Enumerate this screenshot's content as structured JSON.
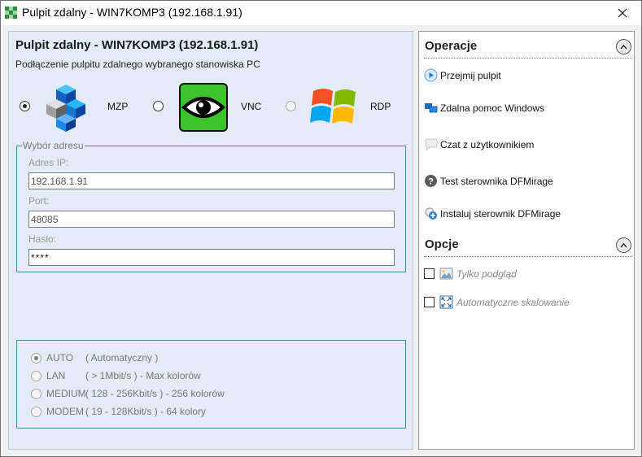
{
  "window": {
    "title": "Pulpit zdalny - WIN7KOMP3 (192.168.1.91)",
    "close_glyph": "✕"
  },
  "left": {
    "title": "Pulpit zdalny - WIN7KOMP3 (192.168.1.91)",
    "subtitle": "Podłączenie pulpitu zdalnego wybranego stanowiska PC",
    "methods": [
      {
        "label": "MZP",
        "selected": true,
        "enabled": true,
        "icon": "mzp-cubes-icon"
      },
      {
        "label": "VNC",
        "selected": false,
        "enabled": true,
        "icon": "vnc-eye-icon"
      },
      {
        "label": "RDP",
        "selected": false,
        "enabled": false,
        "icon": "windows-logo-icon"
      }
    ],
    "address": {
      "legend": "Wybór adresu",
      "ip_label": "Adres IP:",
      "ip_value": "192.168.1.91",
      "port_label": "Port:",
      "port_value": "48085",
      "password_label": "Hasło:",
      "password_value": "****"
    },
    "quality": [
      {
        "name": "AUTO",
        "desc": "( Automatyczny )",
        "selected": true
      },
      {
        "name": "LAN",
        "desc": "( > 1Mbit/s ) - Max kolorów",
        "selected": false
      },
      {
        "name": "MEDIUM",
        "desc": "( 128 - 256Kbit/s ) - 256 kolorów",
        "selected": false
      },
      {
        "name": "MODEM",
        "desc": "( 19 - 128Kbit/s ) - 64 kolory",
        "selected": false
      }
    ]
  },
  "right": {
    "operations_title": "Operacje",
    "operations": [
      {
        "label": "Przejmij pulpit",
        "icon": "play-icon"
      },
      {
        "label": "Zdalna pomoc Windows",
        "icon": "remote-help-icon"
      },
      {
        "label": "Czat z użytkownikiem",
        "icon": "chat-bubble-icon"
      },
      {
        "label": "Test sterownika DFMirage",
        "icon": "question-icon"
      },
      {
        "label": "Instaluj sterownik DFMirage",
        "icon": "install-driver-icon"
      }
    ],
    "options_title": "Opcje",
    "options": [
      {
        "label": "Tylko podgląd",
        "checked": false,
        "icon": "picture-icon"
      },
      {
        "label": "Automatyczne skalowanie",
        "checked": false,
        "icon": "fullscreen-icon"
      }
    ],
    "collapse_glyph": "^"
  },
  "colors": {
    "panel_bg": "#e3ecf6",
    "groupbox_border": "#4d8aa4",
    "vnc_green": "#3ec22e",
    "play_blue": "#2a7fd4"
  }
}
